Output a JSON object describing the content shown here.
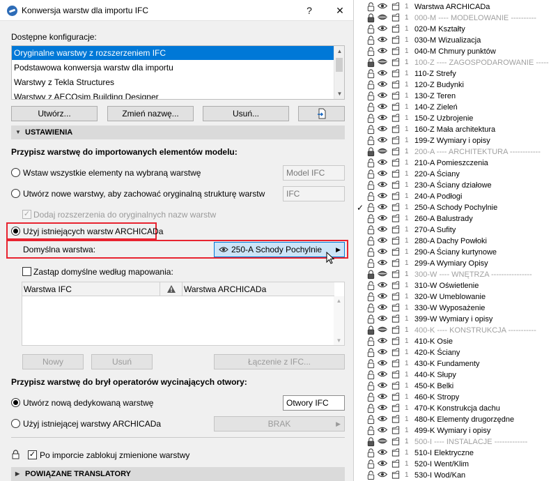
{
  "dialog": {
    "title": "Konwersja warstw dla importu IFC",
    "help_label": "?",
    "close_label": "✕",
    "configs_label": "Dostępne konfiguracje:",
    "configs": [
      "Oryginalne warstwy z rozszerzeniem IFC",
      "Podstawowa konwersja warstw dla importu",
      "Warstwy z  Tekla Structures",
      "Warstwy z AECOsim Building Designer"
    ],
    "selected_config_index": 0,
    "buttons": {
      "create": "Utwórz...",
      "rename": "Zmień nazwę...",
      "delete": "Usuń..."
    },
    "settings_section": "USTAWIENIA",
    "assign_model_label": "Przypisz warstwę do importowanych elementów modelu:",
    "option_single_layer": "Wstaw wszystkie elementy na wybraną warstwę",
    "single_layer_value": "Model IFC",
    "option_new_layers": "Utwórz nowe warstwy, aby zachować oryginalną strukturę warstw",
    "new_layers_value": "IFC",
    "add_extensions_label": "Dodaj rozszerzenia do oryginalnych nazw warstw",
    "option_existing_layers": "Użyj istniejących warstw ARCHICADa",
    "default_layer_label": "Domyślna warstwa:",
    "default_layer_value": "250-A Schody Pochylnie",
    "replace_default_label": "Zastąp domyślne według mapowania:",
    "table": {
      "col_ifc": "Warstwa IFC",
      "col_archicad": "Warstwa ARCHICADa"
    },
    "table_buttons": {
      "new": "Nowy",
      "remove": "Usuń",
      "connect": "Łączenie z IFC..."
    },
    "assign_openings_label": "Przypisz warstwę do brył operatorów wycinających otwory:",
    "option_dedicated": "Utwórz nową dedykowaną warstwę",
    "dedicated_value": "Otwory IFC",
    "option_existing_opening": "Użyj istniejącej warstwy ARCHICADa",
    "existing_opening_value": "BRAK",
    "lock_label": "Po imporcie zablokuj zmienione warstwy",
    "translators_section": "POWIĄZANE TRANSLATORY"
  },
  "layers": {
    "header": "Warstwa ARCHICADa",
    "items": [
      {
        "name": "000-M ---- MODELOWANIE ----------",
        "group": true
      },
      {
        "name": "020-M Kształty"
      },
      {
        "name": "030-M Wizualizacja"
      },
      {
        "name": "040-M Chmury punktów"
      },
      {
        "name": "100-Z ---- ZAGOSPODAROWANIE -----",
        "group": true
      },
      {
        "name": "110-Z Strefy"
      },
      {
        "name": "120-Z Budynki"
      },
      {
        "name": "130-Z Teren"
      },
      {
        "name": "140-Z Zieleń"
      },
      {
        "name": "150-Z Uzbrojenie"
      },
      {
        "name": "160-Z Mała architektura"
      },
      {
        "name": "199-Z Wymiary i opisy"
      },
      {
        "name": "200-A ---- ARCHITEKTURA ------------",
        "group": true
      },
      {
        "name": "210-A Pomieszczenia"
      },
      {
        "name": "220-A Ściany"
      },
      {
        "name": "230-A Ściany działowe"
      },
      {
        "name": "240-A Podłogi"
      },
      {
        "name": "250-A Schody Pochylnie",
        "checked": true
      },
      {
        "name": "260-A Balustrady"
      },
      {
        "name": "270-A Sufity"
      },
      {
        "name": "280-A Dachy Powłoki"
      },
      {
        "name": "290-A Ściany kurtynowe"
      },
      {
        "name": "299-A Wymiary Opisy"
      },
      {
        "name": "300-W ---- WNĘTRZA ----------------",
        "group": true
      },
      {
        "name": "310-W Oświetlenie"
      },
      {
        "name": "320-W Umeblowanie"
      },
      {
        "name": "330-W Wyposażenie"
      },
      {
        "name": "399-W Wymiary i opisy"
      },
      {
        "name": "400-K ---- KONSTRUKCJA -----------",
        "group": true
      },
      {
        "name": "410-K Osie"
      },
      {
        "name": "420-K Ściany"
      },
      {
        "name": "430-K Fundamenty"
      },
      {
        "name": "440-K Słupy"
      },
      {
        "name": "450-K Belki"
      },
      {
        "name": "460-K Stropy"
      },
      {
        "name": "470-K Konstrukcja dachu"
      },
      {
        "name": "480-K Elementy drugorzędne"
      },
      {
        "name": "499-K Wymiary i opisy"
      },
      {
        "name": "500-I ---- INSTALACJE -------------",
        "group": true
      },
      {
        "name": "510-I Elektryczne"
      },
      {
        "name": "520-I Went/Klim"
      },
      {
        "name": "530-I Wod/Kan"
      }
    ]
  }
}
